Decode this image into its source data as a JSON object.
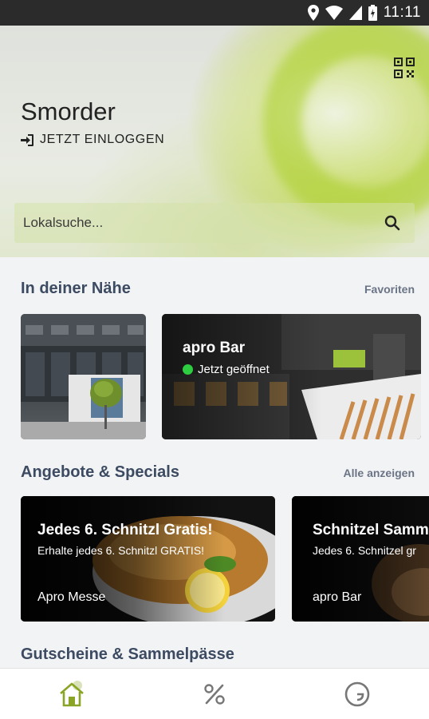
{
  "status_bar": {
    "time": "11:11"
  },
  "header": {
    "title": "Smorder",
    "login_label": "JETZT EINLOGGEN",
    "search_placeholder": "Lokalsuche..."
  },
  "nearby": {
    "title": "In deiner Nähe",
    "link": "Favoriten",
    "cards": [
      {
        "name": "",
        "status": ""
      },
      {
        "name": "apro Bar",
        "status": "Jetzt geöffnet",
        "status_color": "#2ecc40"
      }
    ]
  },
  "offers": {
    "title": "Angebote & Specials",
    "link": "Alle anzeigen",
    "cards": [
      {
        "title": "Jedes 6. Schnitzl Gratis!",
        "subtitle": "Erhalte jedes 6. Schnitzl GRATIS!",
        "venue": "Apro Messe"
      },
      {
        "title": "Schnitzel Samm",
        "subtitle": "Jedes 6. Schnitzel gr",
        "venue": "apro Bar"
      }
    ]
  },
  "vouchers": {
    "title": "Gutscheine & Sammelpässe"
  },
  "bottom_nav": {
    "items": [
      {
        "icon": "home-icon",
        "active": true
      },
      {
        "icon": "percent-icon",
        "active": false
      },
      {
        "icon": "history-icon",
        "active": false
      }
    ]
  },
  "colors": {
    "accent": "#9ab528",
    "section_title": "#3c4a62",
    "status_open": "#2ecc40"
  }
}
